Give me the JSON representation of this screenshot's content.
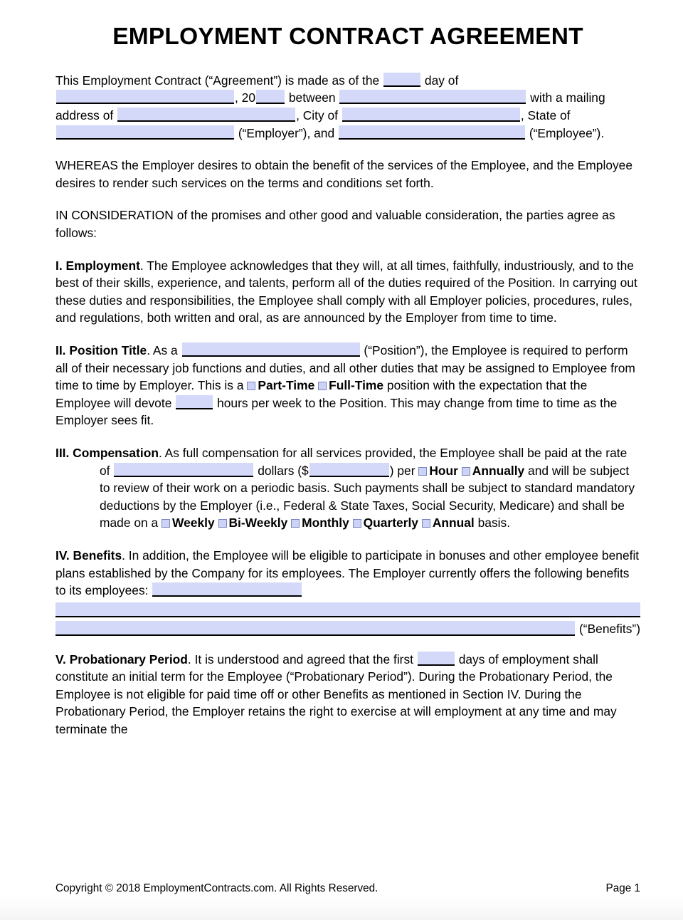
{
  "document": {
    "title": "EMPLOYMENT CONTRACT AGREEMENT"
  },
  "intro": {
    "t1": "This Employment Contract (“Agreement”) is made as of the",
    "t2": "day of",
    "t3": ", 20",
    "t4": "between",
    "t5": "with a mailing address of",
    "t6": ", City of",
    "t7": ",",
    "t8": "State of",
    "t9": "(“Employer”), and",
    "t10": "(“Employee”)."
  },
  "recitals": {
    "whereas": "WHEREAS the Employer desires to obtain the benefit of the services of the Employee, and the Employee desires to render such services on the terms and conditions set forth.",
    "consideration": "IN CONSIDERATION of the promises and other good and valuable consideration, the parties agree as follows:"
  },
  "sections": {
    "employment": {
      "num": "I.",
      "title": "Employment",
      "body": ". The Employee acknowledges that they will, at all times, faithfully, industriously, and to the best of their skills, experience, and talents, perform all of the duties required of the Position. In carrying out these duties and responsibilities, the Employee shall comply with all Employer policies, procedures, rules, and regulations, both written and oral, as are announced by the Employer from time to time."
    },
    "position": {
      "num": "II.",
      "title": "Position Title",
      "b1": ". As a",
      "b2": "(“Position”), the Employee is required to perform all of their necessary job functions and duties, and all other duties that may be assigned to Employee from time to time by Employer. This is a",
      "opt_part_time": "Part-Time",
      "opt_full_time": "Full-Time",
      "b3": "position with the expectation that the Employee will devote",
      "b4": "hours per week to the Position. This may change from time to time as the Employer sees fit."
    },
    "compensation": {
      "num": "III.",
      "title": "Compensation",
      "b1": ". As full compensation for all services provided, the Employee shall",
      "b2": "be paid at the rate of",
      "b3": "dollars ($",
      "b4": ") per",
      "opt_hour": "Hour",
      "opt_annually": "Annually",
      "b5": "and will be subject to review of their work on a periodic basis. Such payments shall be subject to standard mandatory deductions by the Employer (i.e., Federal & State Taxes, Social Security, Medicare) and shall be made on a",
      "freq_weekly": "Weekly",
      "freq_biweekly": "Bi-Weekly",
      "freq_monthly": "Monthly",
      "freq_quarterly": "Quarterly",
      "freq_annual": "Annual",
      "b6": "basis."
    },
    "benefits": {
      "num": "IV.",
      "title": "Benefits",
      "b1": ". In addition, the Employee will be eligible to participate in bonuses and other employee benefit plans established by the Company for its employees. The Employer currently offers the following benefits to its employees:",
      "tail": "(“Benefits”)"
    },
    "probationary": {
      "num": "V.",
      "title": "Probationary Period",
      "b1": ". It is understood and agreed that the first",
      "b2": "days of employment shall constitute an initial term for the Employee (“Probationary Period”). During the Probationary Period, the Employee is not eligible for paid time off or other Benefits as mentioned in Section IV. During the Probationary Period, the Employer retains the right to exercise at will employment at any time and may terminate the"
    }
  },
  "footer": {
    "copyright": "Copyright © 2018 EmploymentContracts.com. All Rights Reserved.",
    "page": "Page 1"
  },
  "colors": {
    "field_fill": "#d4d9fa",
    "checkbox_fill": "#ccd3f5",
    "checkbox_border": "#7b86c4",
    "rule": "#000000"
  }
}
